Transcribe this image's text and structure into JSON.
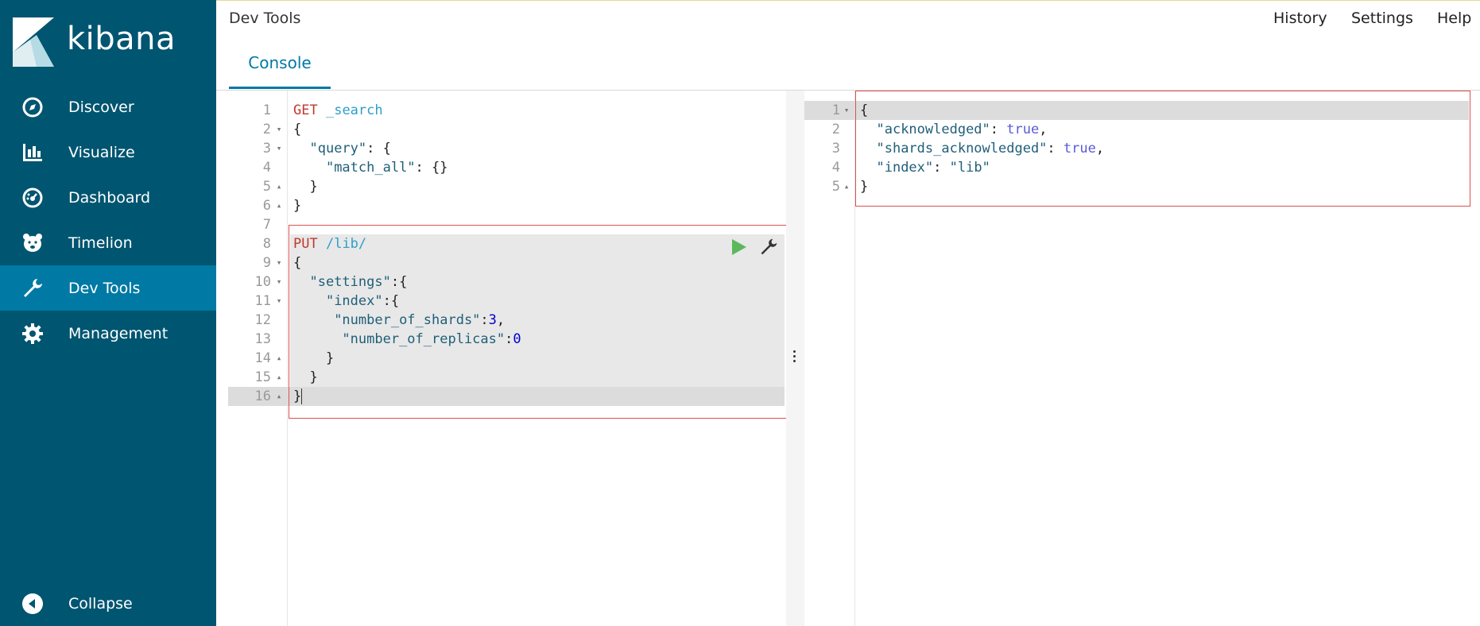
{
  "sidebar": {
    "brand": "kibana",
    "items": [
      {
        "label": "Discover",
        "icon": "compass-icon"
      },
      {
        "label": "Visualize",
        "icon": "bar-chart-icon"
      },
      {
        "label": "Dashboard",
        "icon": "dashboard-gauge-icon"
      },
      {
        "label": "Timelion",
        "icon": "timelion-bear-icon"
      },
      {
        "label": "Dev Tools",
        "icon": "wrench-icon",
        "active": true
      },
      {
        "label": "Management",
        "icon": "gear-icon"
      }
    ],
    "collapse_label": "Collapse",
    "colors": {
      "background": "#005571",
      "active": "#0079a5"
    }
  },
  "header": {
    "title": "Dev Tools",
    "links": [
      "History",
      "Settings",
      "Help"
    ],
    "tabs": [
      {
        "label": "Console",
        "active": true
      }
    ]
  },
  "request_editor": {
    "lines": [
      {
        "n": "1",
        "fold": "",
        "text": "GET _search"
      },
      {
        "n": "2",
        "fold": "▾",
        "text": "{"
      },
      {
        "n": "3",
        "fold": "▾",
        "text": "  \"query\": {"
      },
      {
        "n": "4",
        "fold": "",
        "text": "    \"match_all\": {}"
      },
      {
        "n": "5",
        "fold": "▴",
        "text": "  }"
      },
      {
        "n": "6",
        "fold": "▴",
        "text": "}"
      },
      {
        "n": "7",
        "fold": "",
        "text": ""
      },
      {
        "n": "8",
        "fold": "",
        "text": "PUT /lib/"
      },
      {
        "n": "9",
        "fold": "▾",
        "text": "{"
      },
      {
        "n": "10",
        "fold": "▾",
        "text": "  \"settings\":{"
      },
      {
        "n": "11",
        "fold": "▾",
        "text": "    \"index\":{"
      },
      {
        "n": "12",
        "fold": "",
        "text": "     \"number_of_shards\":3,"
      },
      {
        "n": "13",
        "fold": "",
        "text": "      \"number_of_replicas\":0"
      },
      {
        "n": "14",
        "fold": "▴",
        "text": "    }"
      },
      {
        "n": "15",
        "fold": "▴",
        "text": "  }"
      },
      {
        "n": "16",
        "fold": "▴",
        "text": "}"
      }
    ],
    "active_line": "16"
  },
  "response_editor": {
    "lines": [
      {
        "n": "1",
        "fold": "▾",
        "text": "{"
      },
      {
        "n": "2",
        "fold": "",
        "text": "  \"acknowledged\": true,"
      },
      {
        "n": "3",
        "fold": "",
        "text": "  \"shards_acknowledged\": true,"
      },
      {
        "n": "4",
        "fold": "",
        "text": "  \"index\": \"lib\""
      },
      {
        "n": "5",
        "fold": "▴",
        "text": "}"
      }
    ],
    "active_line": "1"
  },
  "actions": {
    "run": "play-icon",
    "settings": "wrench-icon"
  },
  "highlight_color": "#d9534f"
}
